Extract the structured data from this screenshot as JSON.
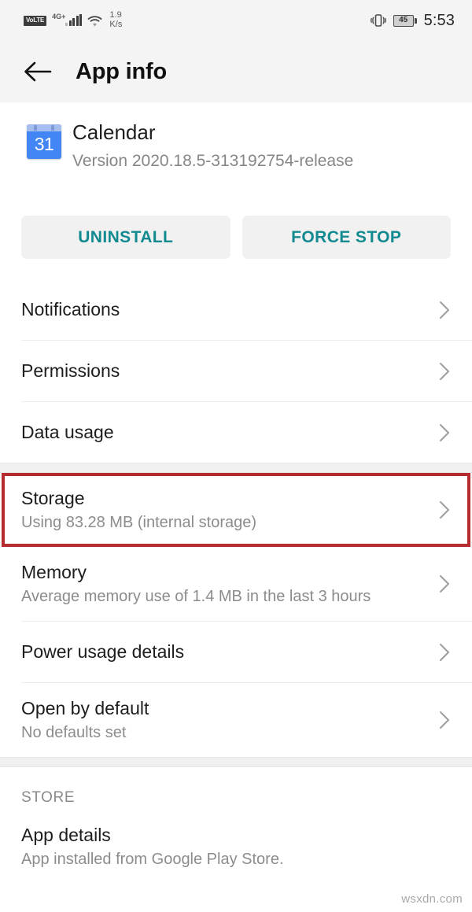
{
  "status_bar": {
    "volte_label": "VoLTE",
    "network_type": "4G+",
    "signal_icon": "signal-bars-icon",
    "wifi_icon": "wifi-icon",
    "data_speed_value": "1.9",
    "data_speed_unit": "K/s",
    "vibrate_icon": "vibrate-icon",
    "battery_level": "45",
    "time": "5:53"
  },
  "app_bar": {
    "back_icon": "back-arrow-icon",
    "title": "App info"
  },
  "app": {
    "icon": "calendar-icon",
    "icon_day": "31",
    "name": "Calendar",
    "version": "Version 2020.18.5-313192754-release"
  },
  "actions": {
    "uninstall_label": "UNINSTALL",
    "force_stop_label": "FORCE STOP",
    "accent_color": "#128a90"
  },
  "sections": [
    {
      "rows": [
        {
          "title": "Notifications",
          "subtitle": "",
          "chevron": "chevron-right-icon"
        },
        {
          "title": "Permissions",
          "subtitle": "",
          "chevron": "chevron-right-icon"
        },
        {
          "title": "Data usage",
          "subtitle": "",
          "chevron": "chevron-right-icon"
        }
      ]
    },
    {
      "rows": [
        {
          "title": "Storage",
          "subtitle": "Using 83.28 MB (internal storage)",
          "chevron": "chevron-right-icon",
          "highlighted": true
        },
        {
          "title": "Memory",
          "subtitle": "Average memory use of 1.4 MB in the last 3 hours",
          "chevron": "chevron-right-icon"
        },
        {
          "title": "Power usage details",
          "subtitle": "",
          "chevron": "chevron-right-icon"
        },
        {
          "title": "Open by default",
          "subtitle": "No defaults set",
          "chevron": "chevron-right-icon"
        }
      ]
    },
    {
      "header": "STORE",
      "rows": [
        {
          "title": "App details",
          "subtitle": "App installed from Google Play Store.",
          "chevron": ""
        }
      ]
    }
  ],
  "highlight": {
    "color": "#b62b2e"
  },
  "watermark": "wsxdn.com"
}
